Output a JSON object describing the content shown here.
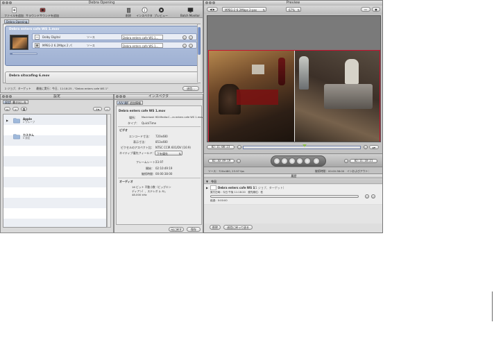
{
  "compressor": {
    "title": "Debra Opening",
    "toolbar": [
      {
        "label": "ファイルを追加",
        "icon": "add-file-icon"
      },
      {
        "label": "サラウンドサウンドを追加",
        "icon": "add-surround-icon"
      },
      {
        "label": "削除",
        "icon": "trash-icon"
      },
      {
        "label": "インスペクタ",
        "icon": "info-icon"
      },
      {
        "label": "プレビュー",
        "icon": "preview-icon"
      },
      {
        "label": "Batch Monitor",
        "icon": "batch-monitor-icon"
      }
    ],
    "tab": "Debra Opening",
    "job1": {
      "name": "Debra enters cafe WS 1.mov",
      "targets": [
        {
          "setting": "Dolby Digital",
          "dest": "ソース",
          "output": "Debra enters cafe WS 1..."
        },
        {
          "setting": "MPEG-2 6.2Mbps 2 パ",
          "dest": "ソース",
          "output": "Debra enters cafe WS 1..."
        }
      ]
    },
    "job2": {
      "name": "Debra sitscafing 6.mov"
    },
    "status": "2 ジョブ、ターゲット　　最後に実行：今日、11:18:25 - \"Debra enters cafe WS 1\"",
    "submit": "送信..."
  },
  "settings": {
    "title": "設定",
    "tabs": [
      "設定",
      "書き出し先"
    ],
    "items": [
      {
        "name": "Apple",
        "sub": "2 グループ"
      },
      {
        "name": "カスタム",
        "sub": "0 設定"
      }
    ]
  },
  "inspector": {
    "title": "インスペクタ",
    "tabs": [
      "A/V 属性",
      "追加情報"
    ],
    "filename": "Debra enters cafe WS 1.mov",
    "location_label": "場所：",
    "location": "Macintosh HD:Media:C...ra enters cafe WS 1.mov",
    "type_label": "タイプ：",
    "type": "QuickTime",
    "video_heading": "ビデオ",
    "video": [
      {
        "label": "エンコード寸法：",
        "value": "720x480"
      },
      {
        "label": "表示寸法：",
        "value": "853x480"
      },
      {
        "label": "ピクセルのアスペクト比：",
        "value": "NTSC CCIR 601/DV (16:9)"
      },
      {
        "label": "ネイティブ優先フィールド：",
        "value": "下を優先"
      },
      {
        "label": "フレームレート：",
        "value": "23.97"
      },
      {
        "label": "開始：",
        "value": "02:10:49:19"
      },
      {
        "label": "継続時間：",
        "value": "00:00:38:00"
      }
    ],
    "audio_heading": "オーディオ",
    "audio": "16 ビット 不動小数（ビッグエン ディアン）、ステレオ (L R)、 48.000 kHz",
    "revert": "元に戻す",
    "save": "保存"
  },
  "preview": {
    "title": "Preview",
    "setting": "MPEG-2 6.2Mbps 2-pas",
    "zoom": "67%",
    "tc_in": "02:11:00:23",
    "tc_start": "02:10:49:19",
    "tc_end": "02:11:18:21",
    "info_left": "ソース：720x480, 23.97 fps",
    "info_right": "継続時間：00:00:38:00　インおよびアウト：",
    "history_title": "履歴",
    "history_date": "今日",
    "history_job": "Debra enters cafe WS 1",
    "history_job_sub": "（1 ジョブ、ターゲット）",
    "history_detail": "実行日時：今日 午後 11:18:20　優先順位：低",
    "history_elapsed": "経過：0:00:00",
    "remove": "削除",
    "resubmit": "送信に戻って送る"
  },
  "colors": {
    "selection": "#aab9d6",
    "video_border": "#c8102e",
    "playhead": "#8fc04a"
  }
}
